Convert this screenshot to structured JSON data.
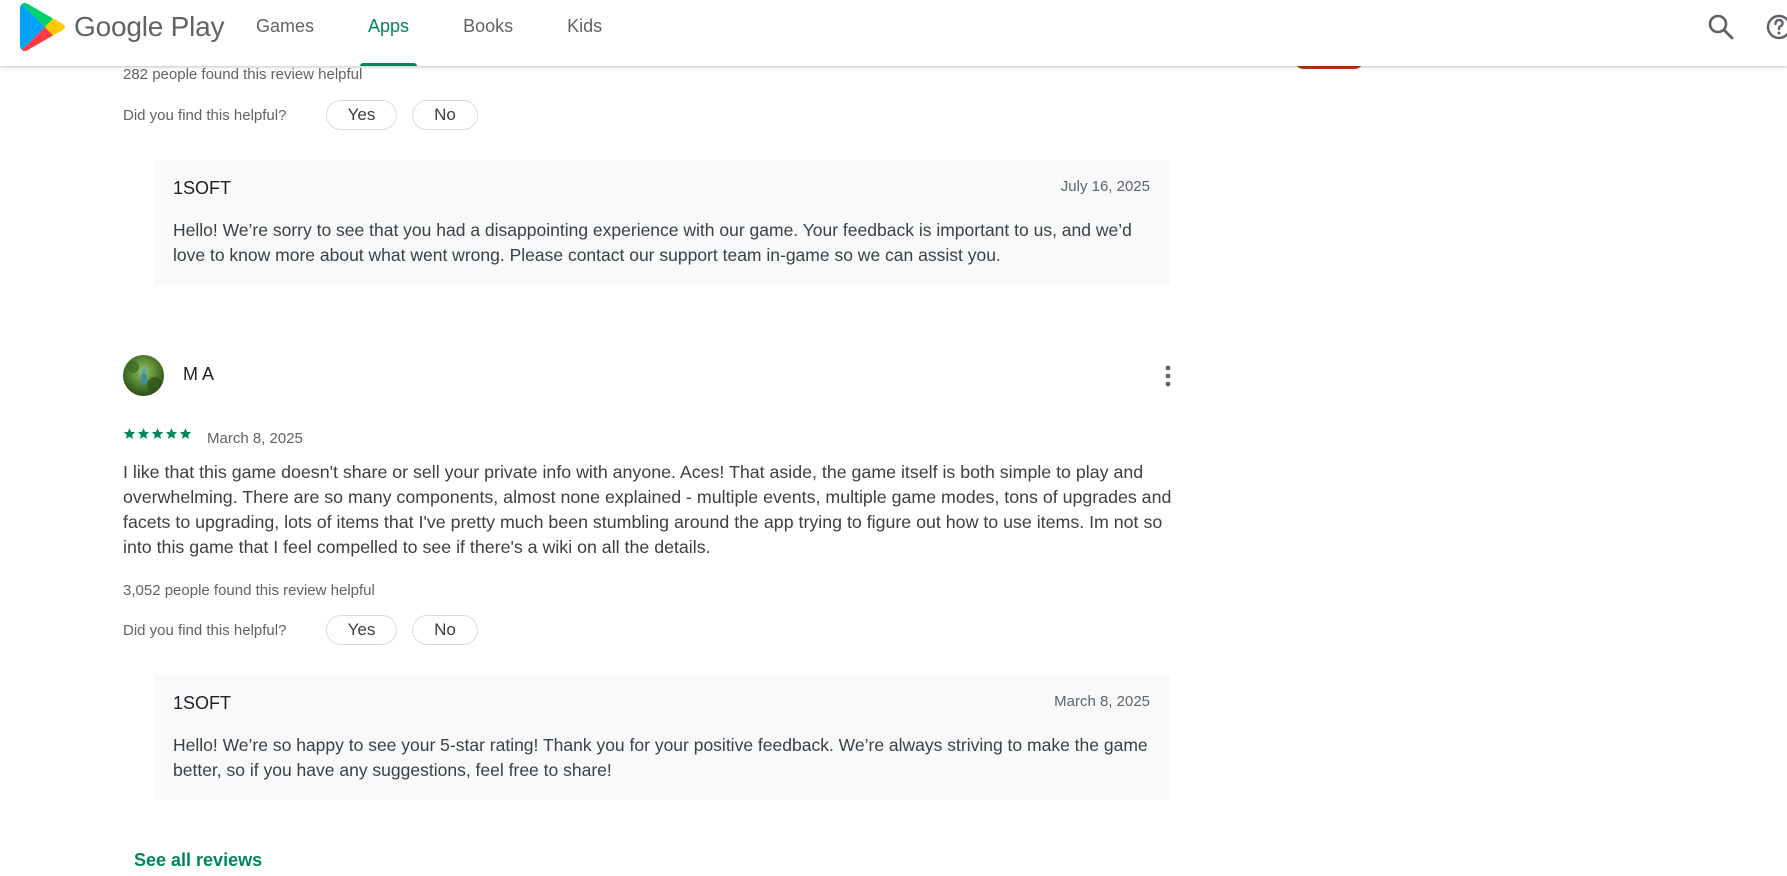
{
  "header": {
    "brand": "Google Play",
    "tabs": [
      {
        "label": "Games",
        "active": false
      },
      {
        "label": "Apps",
        "active": true
      },
      {
        "label": "Books",
        "active": false
      },
      {
        "label": "Kids",
        "active": false
      }
    ],
    "icons": [
      "search-icon",
      "help-icon"
    ]
  },
  "colors": {
    "accent": "#01875f",
    "reply_bg": "#f8f9fa",
    "text_secondary": "#5f6368"
  },
  "review_1": {
    "helpful_count_text": "282 people found this review helpful",
    "helpful_question": "Did you find this helpful?",
    "yes_label": "Yes",
    "no_label": "No",
    "reply": {
      "developer": "1SOFT",
      "date": "July 16, 2025",
      "text": "Hello! We’re sorry to see that you had a disappointing experience with our game. Your feedback is important to us, and we’d love to know more about what went wrong. Please contact our support team in-game so we can assist you."
    }
  },
  "review_2": {
    "reviewer": "M A",
    "rating": 5,
    "date": "March 8, 2025",
    "text": "I like that this game doesn't share or sell your private info with anyone. Aces! That aside, the game itself is both simple to play and overwhelming. There are so many components, almost none explained - multiple events, multiple game modes, tons of upgrades and facets to upgrading, lots of items that I've pretty much been stumbling around the app trying to figure out how to use items. Im not so into this game that I feel compelled to see if there's a wiki on all the details.",
    "helpful_count_text": "3,052 people found this review helpful",
    "helpful_question": "Did you find this helpful?",
    "yes_label": "Yes",
    "no_label": "No",
    "reply": {
      "developer": "1SOFT",
      "date": "March 8, 2025",
      "text": "Hello! We’re so happy to see your 5-star rating! Thank you for your positive feedback. We’re always striving to make the game better, so if you have any suggestions, feel free to share!"
    }
  },
  "see_all_label": "See all reviews"
}
